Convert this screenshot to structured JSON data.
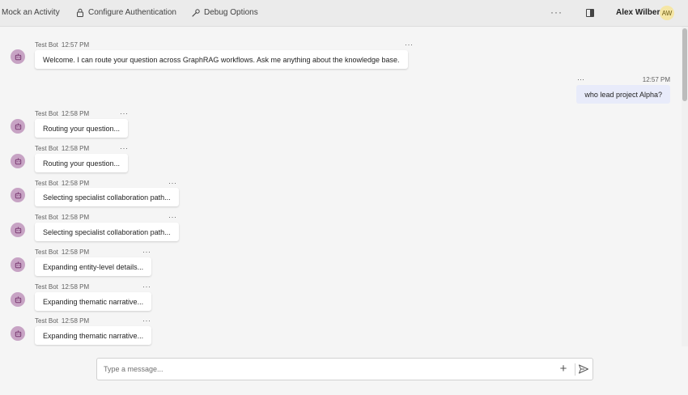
{
  "topbar": {
    "mock_label": "Mock an Activity",
    "auth_label": "Configure Authentication",
    "debug_label": "Debug Options",
    "more_label": "···",
    "user_name": "Alex Wilber",
    "user_initials": "AW"
  },
  "chat": {
    "messages": [
      {
        "sender": "Test Bot",
        "time": "12:57 PM",
        "text": "Welcome. I can route your question across GraphRAG workflows. Ask me anything about the knowledge base."
      },
      {
        "sender": "user",
        "time": "12:57 PM",
        "text": "who lead project Alpha?"
      },
      {
        "sender": "Test Bot",
        "time": "12:58 PM",
        "text": "Routing your question..."
      },
      {
        "sender": "Test Bot",
        "time": "12:58 PM",
        "text": "Routing your question..."
      },
      {
        "sender": "Test Bot",
        "time": "12:58 PM",
        "text": "Selecting specialist collaboration path..."
      },
      {
        "sender": "Test Bot",
        "time": "12:58 PM",
        "text": "Selecting specialist collaboration path..."
      },
      {
        "sender": "Test Bot",
        "time": "12:58 PM",
        "text": "Expanding entity-level details..."
      },
      {
        "sender": "Test Bot",
        "time": "12:58 PM",
        "text": "Expanding thematic narrative..."
      },
      {
        "sender": "Test Bot",
        "time": "12:58 PM",
        "text": "Expanding thematic narrative..."
      }
    ],
    "dots": "···"
  },
  "composer": {
    "placeholder": "Type a message..."
  },
  "colors": {
    "bot_avatar": "#c7a3c4",
    "user_bubble": "#e8ebfa",
    "user_avatar": "#f5e6a5"
  }
}
